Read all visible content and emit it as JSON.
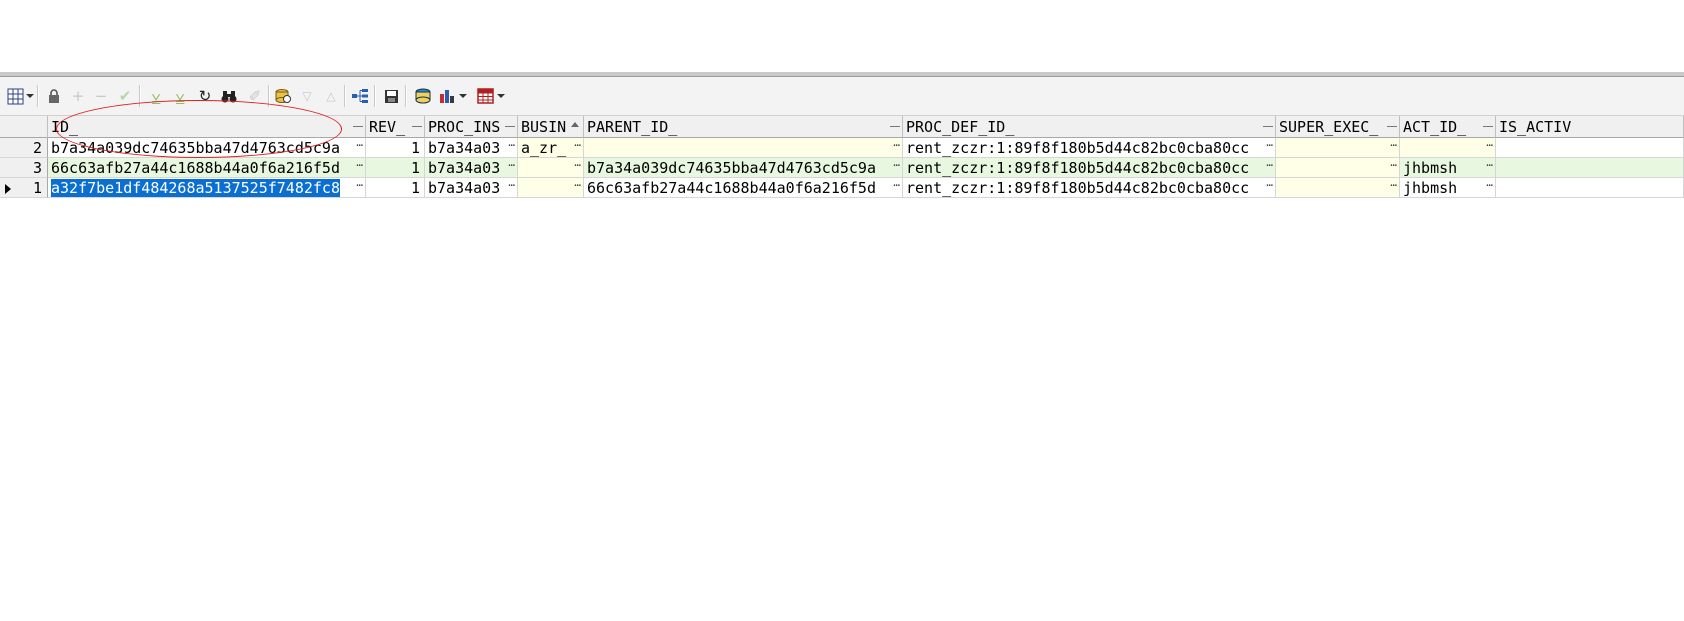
{
  "toolbar": {
    "icons": [
      "grid-view-icon",
      "lock-icon",
      "plus-icon",
      "minus-icon",
      "check-icon",
      "down-arrow-icon",
      "down-arrow-double-icon",
      "refresh-icon",
      "binoculars-icon",
      "eraser-icon",
      "database-export-icon",
      "triangle-down-icon",
      "triangle-up-icon",
      "query-tree-icon",
      "save-icon",
      "database-icon",
      "chart-icon",
      "table-icon"
    ]
  },
  "columns": [
    "ID_",
    "REV_",
    "PROC_INS",
    "BUSIN",
    "PARENT_ID_",
    "PROC_DEF_ID_",
    "SUPER_EXEC_",
    "ACT_ID_",
    "IS_ACTIV"
  ],
  "rows": [
    {
      "num": "2",
      "id": "b7a34a039dc74635bba47d4763cd5c9a",
      "rev": "1",
      "proc_ins": "b7a34a03",
      "busin": "a_zr_",
      "parent_id": "",
      "proc_def_id": "rent_zczr:1:89f8f180b5d44c82bc0cba80cc",
      "super_exec": "",
      "act_id": "",
      "is_active": ""
    },
    {
      "num": "3",
      "id": "66c63afb27a44c1688b44a0f6a216f5d",
      "rev": "1",
      "proc_ins": "b7a34a03",
      "busin": "",
      "parent_id": "b7a34a039dc74635bba47d4763cd5c9a",
      "proc_def_id": "rent_zczr:1:89f8f180b5d44c82bc0cba80cc",
      "super_exec": "",
      "act_id": "jhbmsh",
      "is_active": ""
    },
    {
      "num": "1",
      "id": "a32f7be1df484268a5137525f7482fc8",
      "rev": "1",
      "proc_ins": "b7a34a03",
      "busin": "",
      "parent_id": "66c63afb27a44c1688b44a0f6a216f5d",
      "proc_def_id": "rent_zczr:1:89f8f180b5d44c82bc0cba80cc",
      "super_exec": "",
      "act_id": "jhbmsh",
      "is_active": ""
    }
  ],
  "colors": {
    "annotation": "#e02020",
    "selection": "#0a6fd1"
  }
}
